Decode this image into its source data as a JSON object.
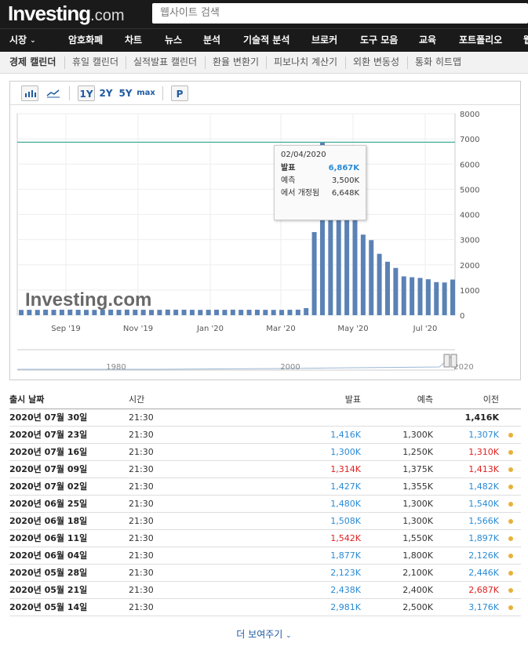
{
  "header": {
    "logo_main": "Investing",
    "logo_suffix": ".com",
    "search_placeholder": "웹사이트 검색"
  },
  "nav": [
    {
      "label": "시장",
      "has_caret": true
    },
    {
      "label": "암호화폐"
    },
    {
      "label": "차트"
    },
    {
      "label": "뉴스"
    },
    {
      "label": "분석"
    },
    {
      "label": "기술적 분석"
    },
    {
      "label": "브로커"
    },
    {
      "label": "도구 모음"
    },
    {
      "label": "교육"
    },
    {
      "label": "포트폴리오"
    },
    {
      "label": "웹"
    }
  ],
  "subnav": [
    {
      "label": "경제 캘린더",
      "active": true
    },
    {
      "label": "휴일 캘린더"
    },
    {
      "label": "실적발표 캘린더"
    },
    {
      "label": "환율 변환기"
    },
    {
      "label": "피보나치 계산기"
    },
    {
      "label": "외환 변동성"
    },
    {
      "label": "통화 히트맵"
    }
  ],
  "toolbar": {
    "bar_chart_icon": "bar-chart-icon",
    "line_chart_icon": "line-chart-icon",
    "range_1y": "1Y",
    "range_2y": "2Y",
    "range_5y": "5Y",
    "range_max": "max",
    "p_button": "P"
  },
  "chart_data": {
    "type": "bar",
    "watermark": "Investing.com",
    "y_ticks": [
      "8000",
      "7000",
      "6000",
      "5000",
      "4000",
      "3000",
      "2000",
      "1000",
      "0"
    ],
    "ylim": [
      0,
      8000
    ],
    "x_ticks": [
      "Sep '19",
      "Nov '19",
      "Jan '20",
      "Mar '20",
      "May '20",
      "Jul '20"
    ],
    "values": [
      210,
      215,
      212,
      220,
      215,
      218,
      222,
      216,
      214,
      212,
      218,
      220,
      215,
      223,
      219,
      216,
      212,
      214,
      224,
      220,
      218,
      215,
      212,
      216,
      219,
      214,
      220,
      215,
      216,
      218,
      214,
      212,
      211,
      216,
      220,
      282,
      3300,
      6867,
      5200,
      6600,
      4400,
      3800,
      3200,
      2981,
      2438,
      2123,
      1877,
      1542,
      1508,
      1480,
      1427,
      1314,
      1300,
      1416
    ],
    "highlight_line": 6867,
    "bar_color": "#5b82b5",
    "line_color": "#44aa99",
    "navigator_labels": [
      "1980",
      "2000",
      "2020"
    ]
  },
  "tooltip": {
    "date": "02/04/2020",
    "actual_label": "발표",
    "actual_value": "6,867K",
    "forecast_label": "예측",
    "forecast_value": "3,500K",
    "revised_label": "에서 개정됨",
    "revised_value": "6,648K"
  },
  "table": {
    "headers": {
      "date": "출시 날짜",
      "time": "시간",
      "actual": "발표",
      "forecast": "예측",
      "previous": "이전"
    },
    "rows": [
      {
        "date": "2020년 07월 30일",
        "time": "21:30",
        "actual": "",
        "actual_color": "#333333",
        "forecast": "",
        "previous": "1,416K",
        "previous_color": "#222222",
        "bold_prev": true,
        "dot": false
      },
      {
        "date": "2020년 07월 23일",
        "time": "21:30",
        "actual": "1,416K",
        "actual_color": "#2a8ad4",
        "forecast": "1,300K",
        "previous": "1,307K",
        "previous_color": "#2a8ad4",
        "dot": true
      },
      {
        "date": "2020년 07월 16일",
        "time": "21:30",
        "actual": "1,300K",
        "actual_color": "#2a8ad4",
        "forecast": "1,250K",
        "previous": "1,310K",
        "previous_color": "#e02020",
        "dot": true
      },
      {
        "date": "2020년 07월 09일",
        "time": "21:30",
        "actual": "1,314K",
        "actual_color": "#e02020",
        "forecast": "1,375K",
        "previous": "1,413K",
        "previous_color": "#e02020",
        "dot": true
      },
      {
        "date": "2020년 07월 02일",
        "time": "21:30",
        "actual": "1,427K",
        "actual_color": "#2a8ad4",
        "forecast": "1,355K",
        "previous": "1,482K",
        "previous_color": "#2a8ad4",
        "dot": true
      },
      {
        "date": "2020년 06월 25일",
        "time": "21:30",
        "actual": "1,480K",
        "actual_color": "#2a8ad4",
        "forecast": "1,300K",
        "previous": "1,540K",
        "previous_color": "#2a8ad4",
        "dot": true
      },
      {
        "date": "2020년 06월 18일",
        "time": "21:30",
        "actual": "1,508K",
        "actual_color": "#2a8ad4",
        "forecast": "1,300K",
        "previous": "1,566K",
        "previous_color": "#2a8ad4",
        "dot": true
      },
      {
        "date": "2020년 06월 11일",
        "time": "21:30",
        "actual": "1,542K",
        "actual_color": "#e02020",
        "forecast": "1,550K",
        "previous": "1,897K",
        "previous_color": "#2a8ad4",
        "dot": true
      },
      {
        "date": "2020년 06월 04일",
        "time": "21:30",
        "actual": "1,877K",
        "actual_color": "#2a8ad4",
        "forecast": "1,800K",
        "previous": "2,126K",
        "previous_color": "#2a8ad4",
        "dot": true
      },
      {
        "date": "2020년 05월 28일",
        "time": "21:30",
        "actual": "2,123K",
        "actual_color": "#2a8ad4",
        "forecast": "2,100K",
        "previous": "2,446K",
        "previous_color": "#2a8ad4",
        "dot": true
      },
      {
        "date": "2020년 05월 21일",
        "time": "21:30",
        "actual": "2,438K",
        "actual_color": "#2a8ad4",
        "forecast": "2,400K",
        "previous": "2,687K",
        "previous_color": "#e02020",
        "dot": true
      },
      {
        "date": "2020년 05월 14일",
        "time": "21:30",
        "actual": "2,981K",
        "actual_color": "#2a8ad4",
        "forecast": "2,500K",
        "previous": "3,176K",
        "previous_color": "#2a8ad4",
        "dot": true
      }
    ]
  },
  "show_more": "더 보여주기"
}
